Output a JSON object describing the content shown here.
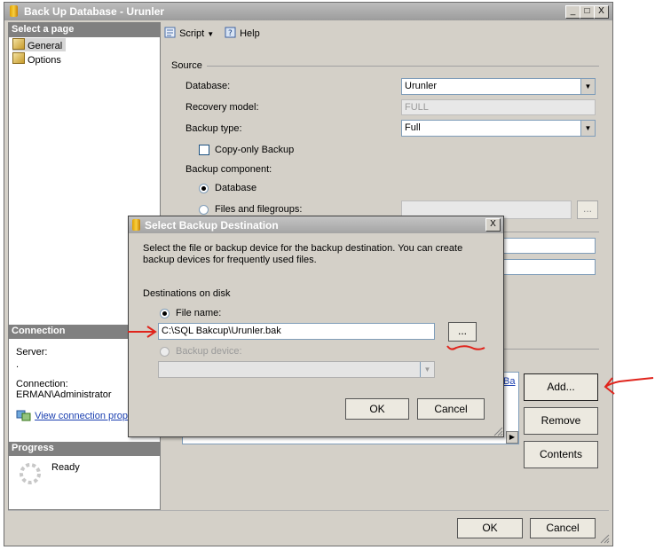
{
  "main_window": {
    "title": "Back Up Database - Urunler",
    "controls": [
      "_",
      "□",
      "X"
    ]
  },
  "left_pane": {
    "select_page_header": "Select a page",
    "pages": [
      {
        "label": "General",
        "icon": "page-icon",
        "selected": true
      },
      {
        "label": "Options",
        "icon": "page-icon",
        "selected": false
      }
    ],
    "connection_header": "Connection",
    "server_label": "Server:",
    "server_value": ".",
    "connection_label": "Connection:",
    "connection_value": "ERMAN\\Administrator",
    "view_link": "View connection prope",
    "progress_header": "Progress",
    "progress_status": "Ready"
  },
  "toolbar": {
    "script_label": "Script",
    "help_label": "Help"
  },
  "source": {
    "group_label": "Source",
    "database_label": "Database:",
    "database_value": "Urunler",
    "recovery_label": "Recovery model:",
    "recovery_value": "FULL",
    "backup_type_label": "Backup type:",
    "backup_type_value": "Full",
    "copy_only_label": "Copy-only Backup",
    "component_label": "Backup component:",
    "component_database": "Database",
    "component_files": "Files and filegroups:",
    "files_browse": "..."
  },
  "destination_list": {
    "partial_item": ".Ba"
  },
  "side_buttons": {
    "add": "Add...",
    "remove": "Remove",
    "contents": "Contents"
  },
  "footer": {
    "ok": "OK",
    "cancel": "Cancel"
  },
  "dialog": {
    "title": "Select Backup Destination",
    "close": "X",
    "description": "Select the file or backup device for the backup destination. You can create backup devices for frequently used files.",
    "destinations_label": "Destinations on disk",
    "file_name_label": "File name:",
    "file_name_value": "C:\\SQL Bakcup\\Urunler.bak",
    "browse": "...",
    "backup_device_label": "Backup device:",
    "ok": "OK",
    "cancel": "Cancel"
  },
  "colors": {
    "annotation_red": "#e0241c",
    "window_gray": "#d4d0c8",
    "link_blue": "#1a3fb0"
  }
}
